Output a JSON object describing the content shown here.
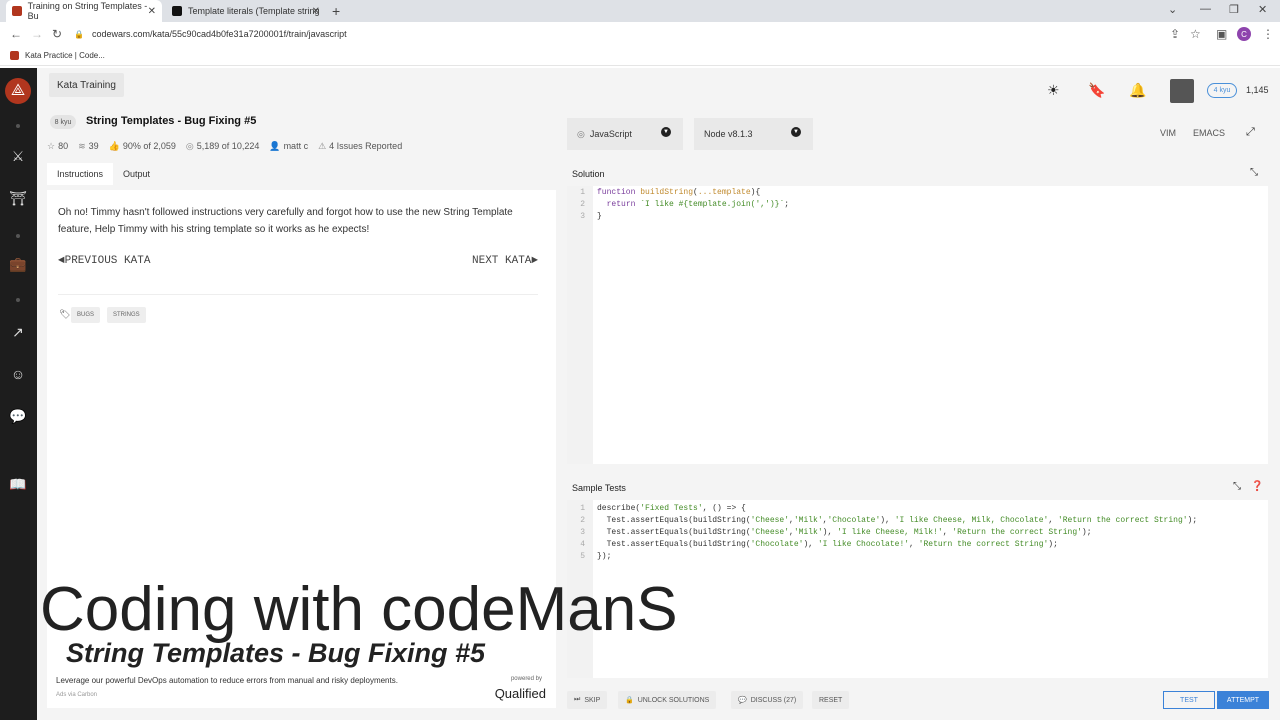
{
  "browser": {
    "tabs": [
      {
        "title": "Training on String Templates - Bu",
        "active": true
      },
      {
        "title": "Template literals (Template string",
        "active": false
      }
    ],
    "url": "codewars.com/kata/55c90cad4b0fe31a7200001f/train/javascript",
    "bookmark": "Kata Practice | Code..."
  },
  "header": {
    "section": "Kata Training",
    "rank_badge": "4 kyu",
    "honor": "1,145",
    "profile_initial": "C"
  },
  "kata": {
    "kyu": "8 kyu",
    "title": "String Templates - Bug Fixing #5",
    "stats": {
      "stars": "80",
      "collections": "39",
      "satisfaction": "90% of 2,059",
      "completions": "5,189 of 10,224",
      "author": "matt c",
      "issues": "4 Issues Reported"
    },
    "tabs": [
      "Instructions",
      "Output"
    ],
    "description": "Oh no! Timmy hasn't followed instructions very carefully and forgot how to use the new String Template feature, Help Timmy with his string template so it works as he expects!",
    "prev": "◄PREVIOUS KATA",
    "next": "NEXT KATA►",
    "tags": [
      "BUGS",
      "STRINGS"
    ]
  },
  "ad": {
    "text": "Leverage our powerful DevOps automation to reduce errors from manual and risky deployments.",
    "source": "Ads via Carbon",
    "powered": "powered by",
    "brand": "Qualified"
  },
  "editor": {
    "language": "JavaScript",
    "runtime": "Node v8.1.3",
    "modes": [
      "VIM",
      "EMACS"
    ],
    "solution_label": "Solution",
    "tests_label": "Sample Tests",
    "solution_lines": [
      "function buildString(...template){",
      "  return `I like #{template.join(',')}`;",
      "}"
    ],
    "test_lines": [
      "describe('Fixed Tests', () => {",
      "  Test.assertEquals(buildString('Cheese','Milk','Chocolate'), 'I like Cheese, Milk, Chocolate', 'Return the correct String');",
      "  Test.assertEquals(buildString('Cheese','Milk'), 'I like Cheese, Milk!', 'Return the correct String');",
      "  Test.assertEquals(buildString('Chocolate'), 'I like Chocolate!', 'Return the correct String');",
      "});"
    ]
  },
  "actions": {
    "skip": "SKIP",
    "unlock": "UNLOCK SOLUTIONS",
    "discuss": "DISCUSS (27)",
    "reset": "RESET",
    "test": "TEST",
    "attempt": "ATTEMPT"
  },
  "overlay": {
    "channel": "Coding with codeManS",
    "episode": "String Templates - Bug Fixing #5"
  }
}
